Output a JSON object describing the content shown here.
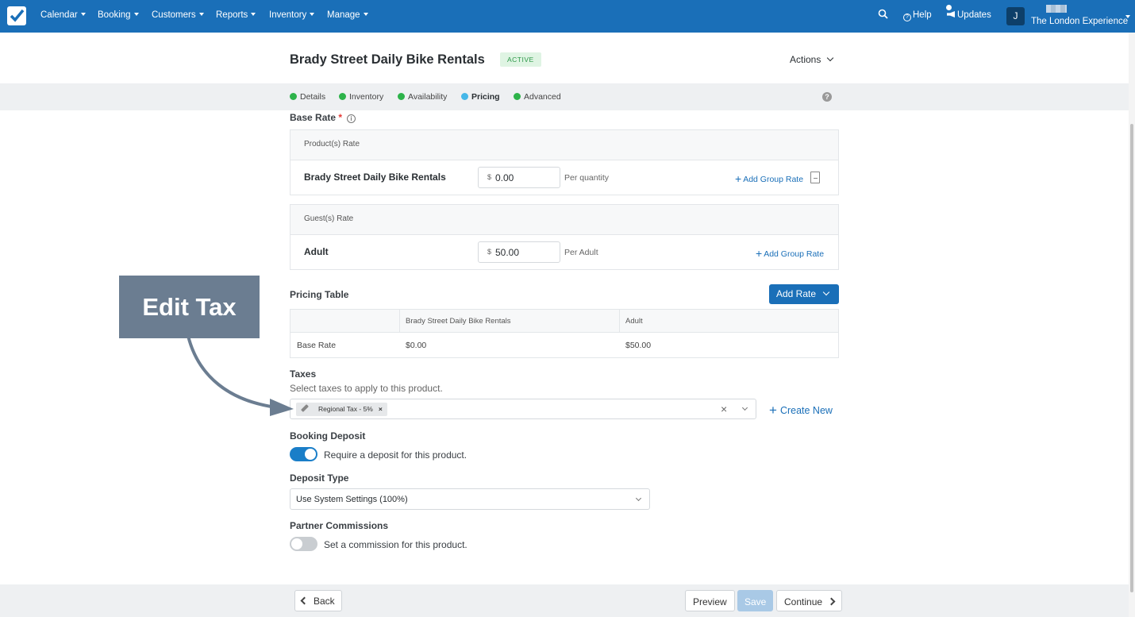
{
  "nav": {
    "items": [
      "Calendar",
      "Booking",
      "Customers",
      "Reports",
      "Inventory",
      "Manage"
    ],
    "search_icon": "search-icon",
    "help": "Help",
    "updates": "Updates",
    "avatar_initial": "J",
    "company": "The London Experience"
  },
  "header": {
    "title": "Brady Street Daily Bike Rentals",
    "status": "ACTIVE",
    "actions": "Actions"
  },
  "steps": [
    "Details",
    "Inventory",
    "Availability",
    "Pricing",
    "Advanced"
  ],
  "base_rate": {
    "label": "Base Rate",
    "required": "*",
    "products_head": "Product(s) Rate",
    "product_name": "Brady Street Daily Bike Rentals",
    "product_currency": "$",
    "product_value": "0.00",
    "product_per": "Per quantity",
    "add_group_rate": "Add Group Rate",
    "guests_head": "Guest(s) Rate",
    "guest_name": "Adult",
    "guest_currency": "$",
    "guest_value": "50.00",
    "guest_per": "Per Adult"
  },
  "pricing_table": {
    "label": "Pricing Table",
    "add_rate": "Add Rate",
    "headers": [
      "",
      "Brady Street Daily Bike Rentals",
      "Adult"
    ],
    "row": [
      "Base Rate",
      "$0.00",
      "$50.00"
    ]
  },
  "taxes": {
    "label": "Taxes",
    "help": "Select taxes to apply to this product.",
    "selected_tag": "Regional Tax - 5%",
    "tag_remove": "×",
    "clear": "×",
    "create_new": "Create New"
  },
  "booking_deposit": {
    "label": "Booking Deposit",
    "toggle_text": "Require a deposit for this product.",
    "enabled": true
  },
  "deposit_type": {
    "label": "Deposit Type",
    "selected": "Use System Settings (100%)"
  },
  "partner_commissions": {
    "label": "Partner Commissions",
    "toggle_text": "Set a commission for this product.",
    "enabled": false
  },
  "footer": {
    "back": "Back",
    "preview": "Preview",
    "save": "Save",
    "continue": "Continue"
  },
  "callout": {
    "text": "Edit Tax"
  },
  "colors": {
    "brand": "#1a6fb8",
    "success": "#2db34a",
    "active_step": "#45b7e8",
    "callout": "#6b7d91"
  }
}
